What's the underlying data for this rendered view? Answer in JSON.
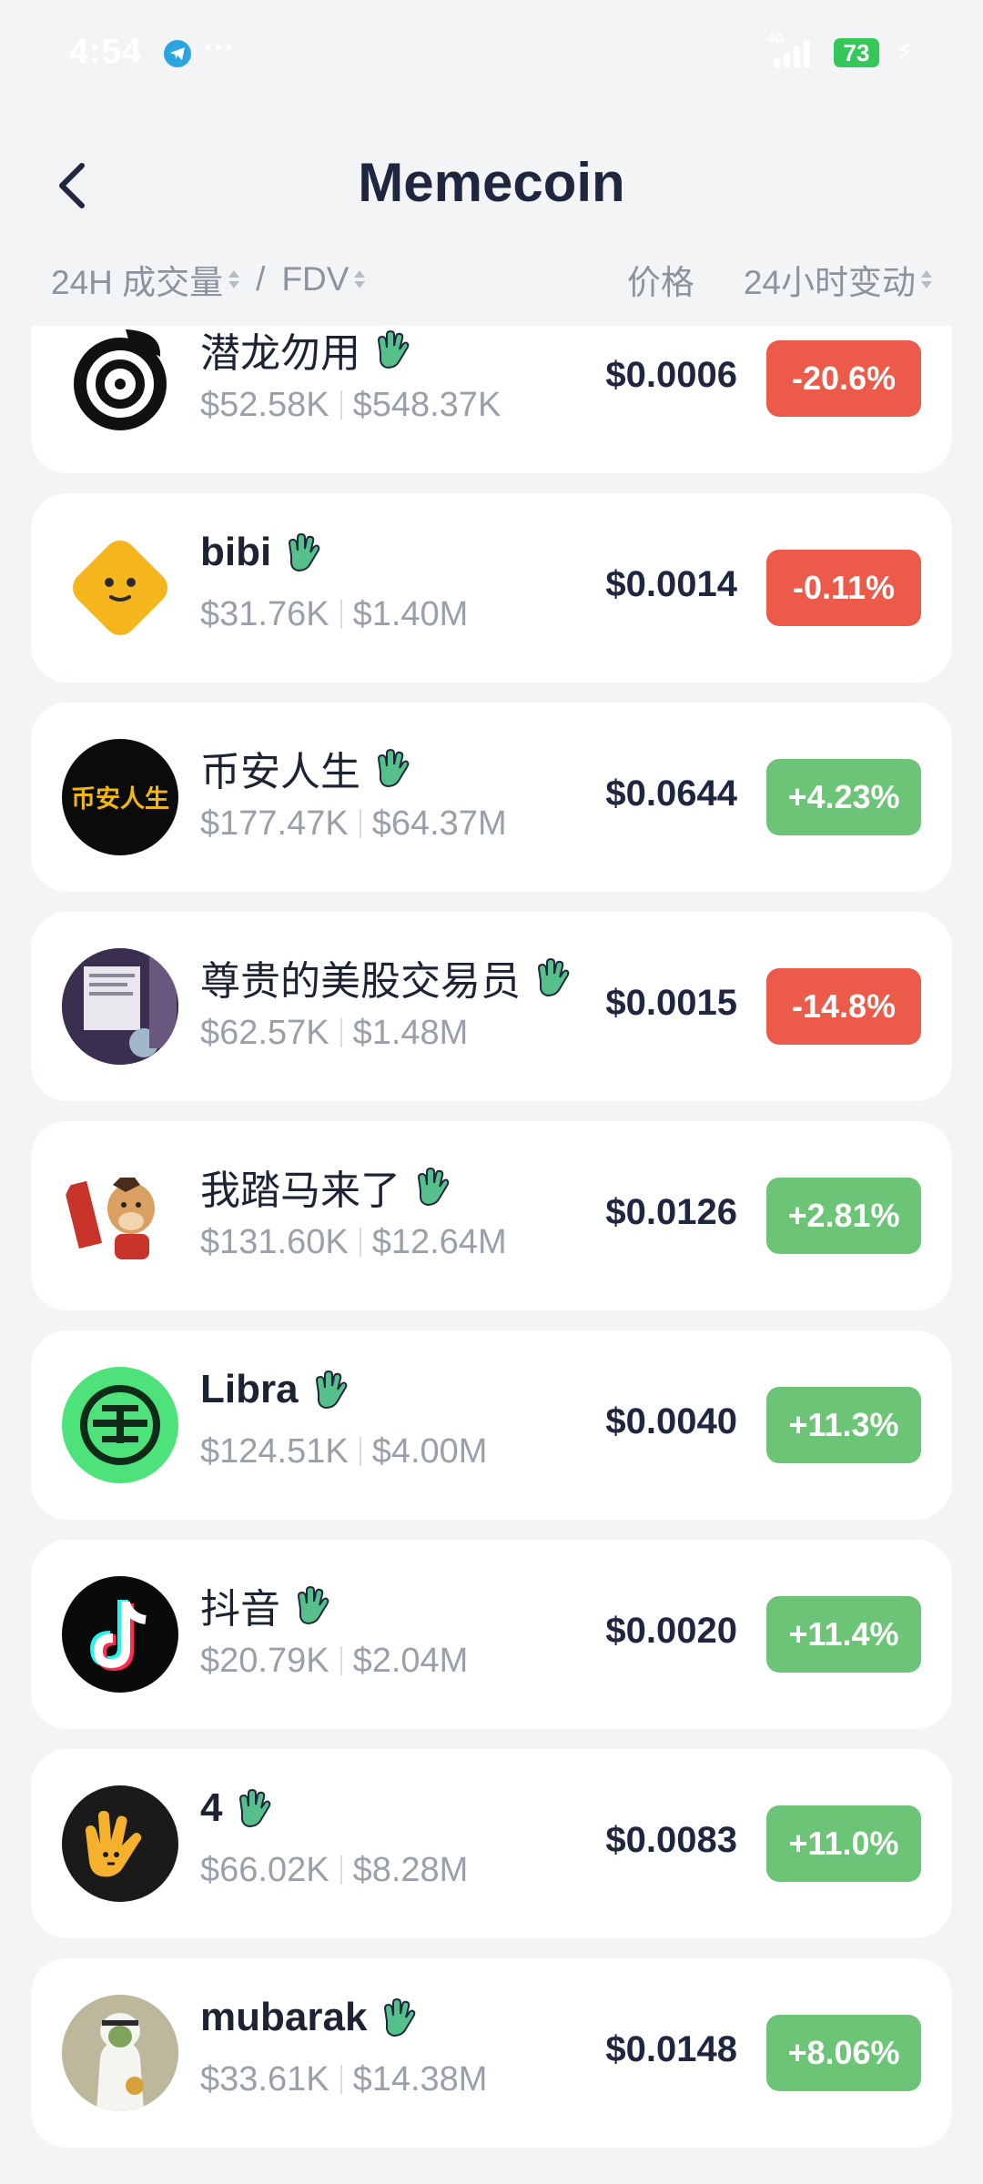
{
  "status_bar": {
    "time": "4:54",
    "dots": "···",
    "network": "4G",
    "battery": "73",
    "colors": {
      "telegram": "#2aa5e0",
      "battery": "#35c759"
    }
  },
  "header": {
    "title": "Memecoin",
    "back_icon": "chevron-left-icon"
  },
  "columns": {
    "volume": "24H 成交量",
    "separator": "/",
    "fdv": "FDV",
    "price": "价格",
    "change": "24小时变动"
  },
  "colors": {
    "negative": "#ec5b4a",
    "positive": "#6cc576",
    "hand_icon": "#56c08a"
  },
  "coins": [
    {
      "name": "潜龙勿用",
      "volume": "$52.58K",
      "fdv": "$548.37K",
      "price": "$0.0006",
      "change": "-20.6%",
      "trend": "neg"
    },
    {
      "name": "bibi",
      "volume": "$31.76K",
      "fdv": "$1.40M",
      "price": "$0.0014",
      "change": "-0.11%",
      "trend": "neg"
    },
    {
      "name": "币安人生",
      "volume": "$177.47K",
      "fdv": "$64.37M",
      "price": "$0.0644",
      "change": "+4.23%",
      "trend": "pos",
      "avatar_text": "币安人生"
    },
    {
      "name": "尊贵的美股交易员",
      "volume": "$62.57K",
      "fdv": "$1.48M",
      "price": "$0.0015",
      "change": "-14.8%",
      "trend": "neg"
    },
    {
      "name": "我踏马来了",
      "volume": "$131.60K",
      "fdv": "$12.64M",
      "price": "$0.0126",
      "change": "+2.81%",
      "trend": "pos"
    },
    {
      "name": "Libra",
      "volume": "$124.51K",
      "fdv": "$4.00M",
      "price": "$0.0040",
      "change": "+11.3%",
      "trend": "pos"
    },
    {
      "name": "抖音",
      "volume": "$20.79K",
      "fdv": "$2.04M",
      "price": "$0.0020",
      "change": "+11.4%",
      "trend": "pos"
    },
    {
      "name": "4",
      "volume": "$66.02K",
      "fdv": "$8.28M",
      "price": "$0.0083",
      "change": "+11.0%",
      "trend": "pos"
    },
    {
      "name": "mubarak",
      "volume": "$33.61K",
      "fdv": "$14.38M",
      "price": "$0.0148",
      "change": "+8.06%",
      "trend": "pos"
    }
  ]
}
